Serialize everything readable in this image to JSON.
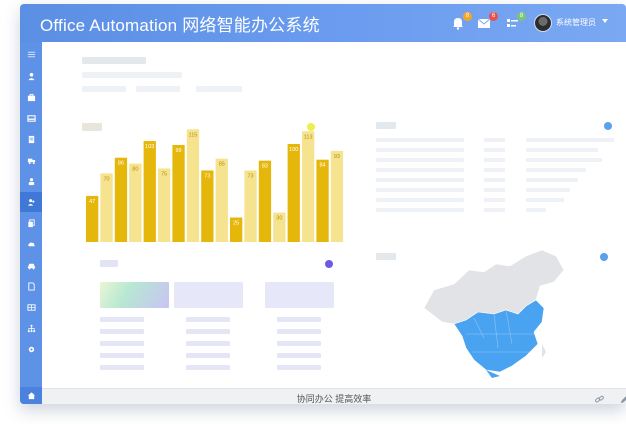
{
  "header": {
    "app_title": "Office Automation 网络智能办公系统",
    "user_name": "系统管理员",
    "notifications": [
      {
        "icon": "bell-icon",
        "count": "8",
        "color": "#f5a623"
      },
      {
        "icon": "mail-icon",
        "count": "6",
        "color": "#e8524a"
      },
      {
        "icon": "task-icon",
        "count": "8",
        "color": "#7cc576"
      }
    ]
  },
  "sidebar": {
    "items": [
      {
        "name": "menu-icon"
      },
      {
        "name": "user-icon"
      },
      {
        "name": "briefcase-icon"
      },
      {
        "name": "inbox-icon"
      },
      {
        "name": "document-icon"
      },
      {
        "name": "truck-icon"
      },
      {
        "name": "person-icon"
      },
      {
        "name": "group-icon"
      },
      {
        "name": "copy-icon"
      },
      {
        "name": "cloud-icon"
      },
      {
        "name": "car-icon"
      },
      {
        "name": "file-icon"
      },
      {
        "name": "table-icon"
      },
      {
        "name": "org-chart-icon"
      },
      {
        "name": "settings-icon"
      }
    ],
    "active_index": 7,
    "bottom": {
      "name": "home-icon"
    }
  },
  "footer": {
    "slogan": "协同办公 提高效率"
  },
  "colors": {
    "accent": "#5b8fe4",
    "bar_dark": "#e6b70b",
    "bar_light": "#f6e38f",
    "map_highlight": "#4aa3f0"
  },
  "chart_data": {
    "type": "bar",
    "title": "",
    "xlabel": "",
    "ylabel": "",
    "ylim": [
      0,
      120
    ],
    "values": [
      47,
      70,
      86,
      80,
      103,
      75,
      99,
      115,
      73,
      85,
      25,
      73,
      83,
      30,
      100,
      113,
      84,
      93
    ]
  }
}
